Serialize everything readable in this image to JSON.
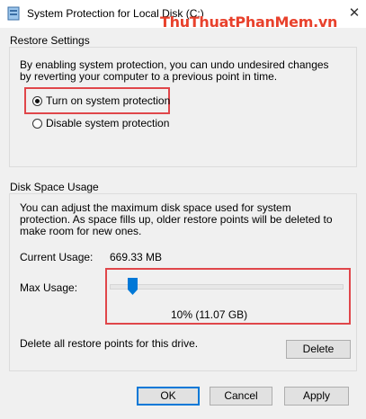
{
  "window": {
    "title": "System Protection for Local Disk (C:)",
    "watermark": "ThuThuatPhanMem.vn",
    "close_glyph": "✕"
  },
  "restore": {
    "group_label": "Restore Settings",
    "description": "By enabling system protection, you can undo undesired changes by reverting your computer to a previous point in time.",
    "options": [
      {
        "label": "Turn on system protection",
        "checked": true
      },
      {
        "label": "Disable system protection",
        "checked": false
      }
    ]
  },
  "disk": {
    "group_label": "Disk Space Usage",
    "description": "You can adjust the maximum disk space used for system protection. As space fills up, older restore points will be deleted to make room for new ones.",
    "current_usage_label": "Current Usage:",
    "current_usage_value": "669.33 MB",
    "max_usage_label": "Max Usage:",
    "max_usage_value": "10% (11.07 GB)",
    "max_usage_fraction": 0.1,
    "delete_text": "Delete all restore points for this drive.",
    "delete_button": "Delete"
  },
  "buttons": {
    "ok": "OK",
    "cancel": "Cancel",
    "apply": "Apply"
  },
  "colors": {
    "highlight": "#e0464a",
    "slider_thumb": "#0078d7",
    "watermark": "#e8412c"
  }
}
